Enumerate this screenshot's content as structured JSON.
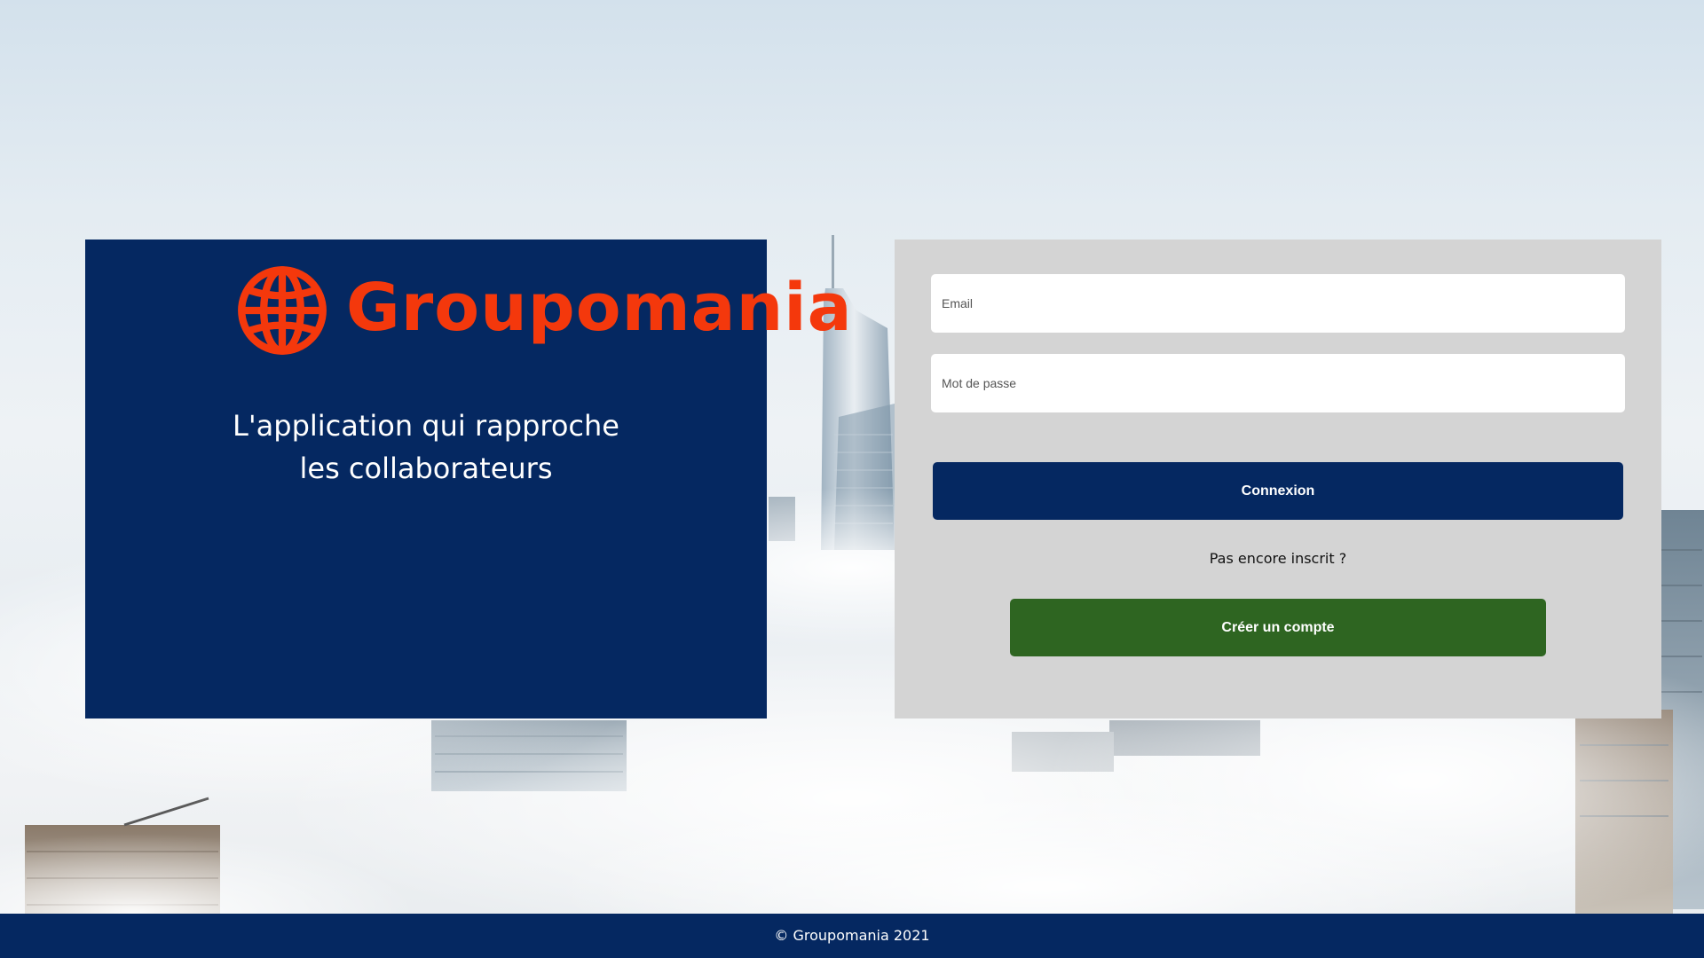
{
  "brand": {
    "name": "Groupomania",
    "tagline": "L'application qui rapproche les collaborateurs",
    "logo_icon": "globe-icon",
    "logo_color": "#f4380c",
    "panel_color": "#052861"
  },
  "login": {
    "email_placeholder": "Email",
    "password_placeholder": "Mot de passe",
    "login_label": "Connexion",
    "not_registered_text": "Pas encore inscrit ?",
    "register_label": "Créer un compte",
    "login_color": "#052861",
    "register_color": "#2e6521"
  },
  "footer": {
    "copyright": "© Groupomania 2021"
  }
}
